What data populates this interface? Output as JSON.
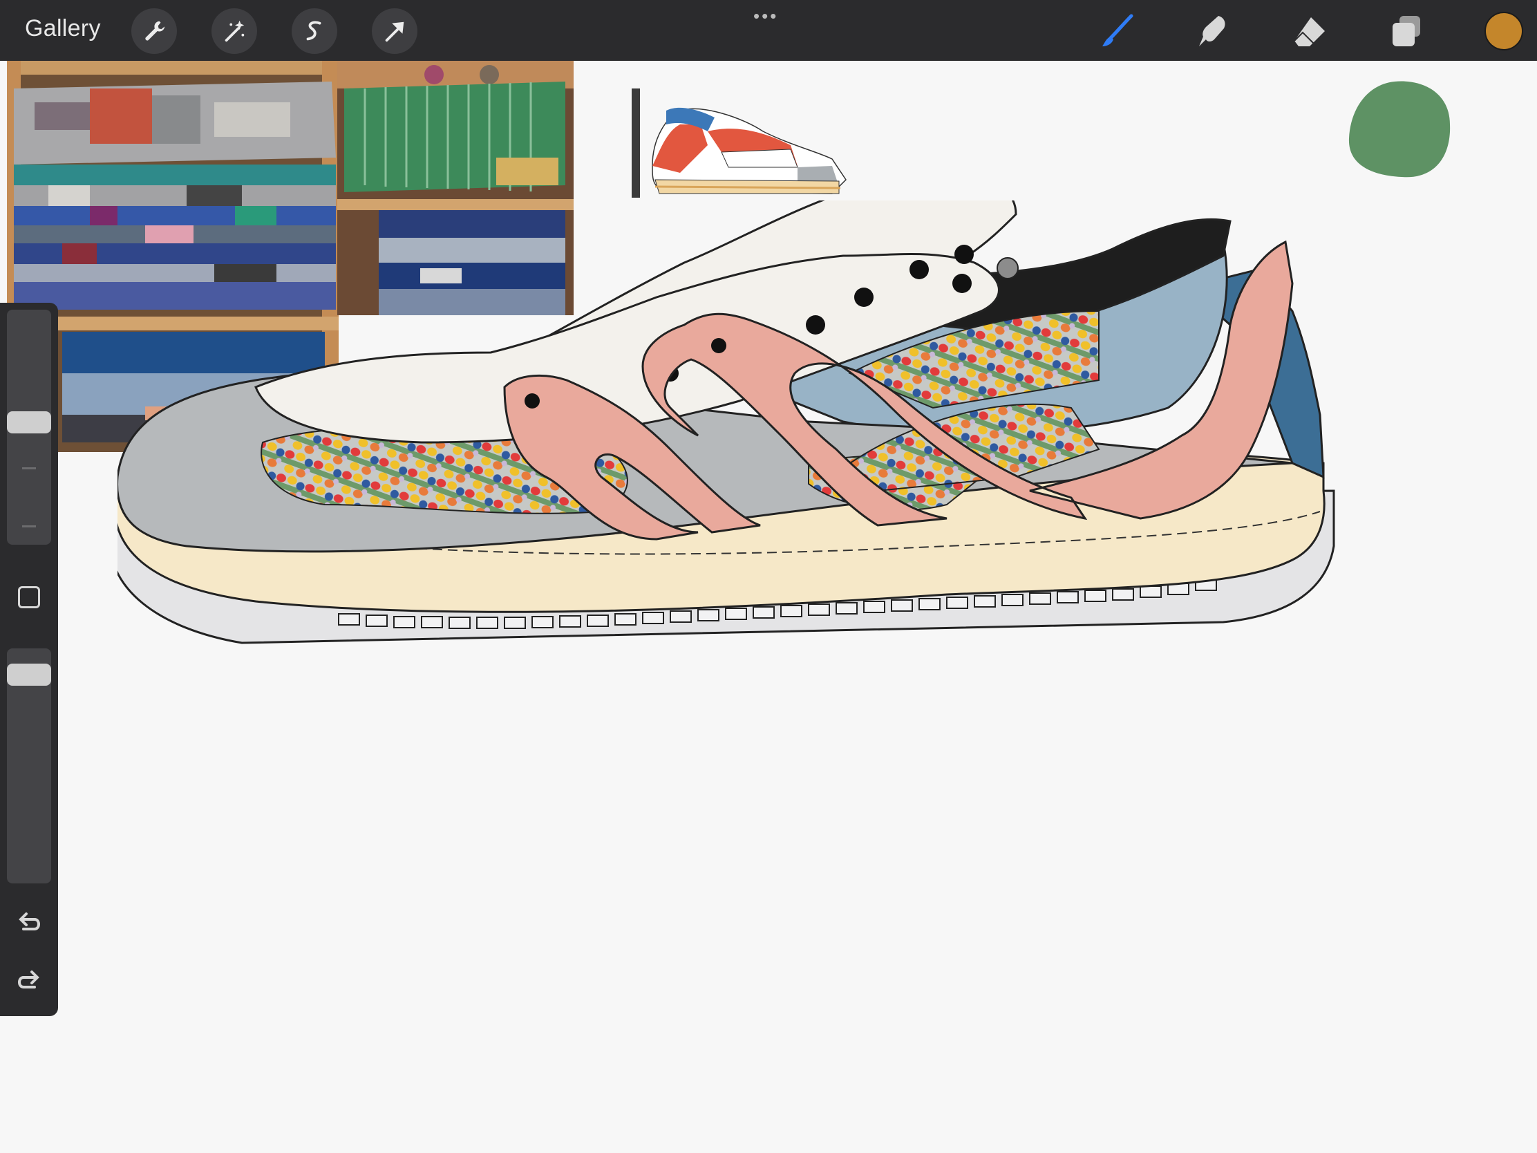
{
  "topbar": {
    "gallery_label": "Gallery",
    "left_tools": [
      {
        "icon": "wrench-icon",
        "name": "actions"
      },
      {
        "icon": "magic-wand-icon",
        "name": "adjustments"
      },
      {
        "icon": "selection-icon",
        "name": "selection"
      },
      {
        "icon": "arrow-cursor-icon",
        "name": "transform"
      }
    ],
    "grabber": "•••",
    "right_tools": [
      {
        "icon": "brush-icon",
        "name": "paint",
        "active": true
      },
      {
        "icon": "smudge-icon",
        "name": "smudge"
      },
      {
        "icon": "eraser-icon",
        "name": "erase"
      },
      {
        "icon": "layers-icon",
        "name": "layers"
      }
    ],
    "current_color": "#c4862b"
  },
  "sidebar": {
    "brush_size_level": 0.5,
    "opacity_level": 0.05,
    "modify_button": "square-modify-icon",
    "undo_icon": "undo-icon",
    "redo_icon": "redo-icon"
  },
  "canvas": {
    "background": "#f7f7f7",
    "reference_images": [
      "folded-blankets-stack",
      "green-woven-blankets-shelf"
    ],
    "preview_image": "sneaker-color-reference",
    "accent_blob_color": "#5e9264",
    "brush_dot_color": "#e6b332",
    "sneaker_colors": {
      "toe": "#b6b9bb",
      "sole": "#f6e8c8",
      "outsole": "#e4e4e6",
      "pink_overlay": "#e9a99c",
      "quarter_blue": "#98b3c6",
      "heel_blue": "#3c6e95",
      "collar": "#1e1e1e",
      "lace_panel": "#f3f1ec",
      "pattern_green": "#6d9a6a"
    }
  }
}
